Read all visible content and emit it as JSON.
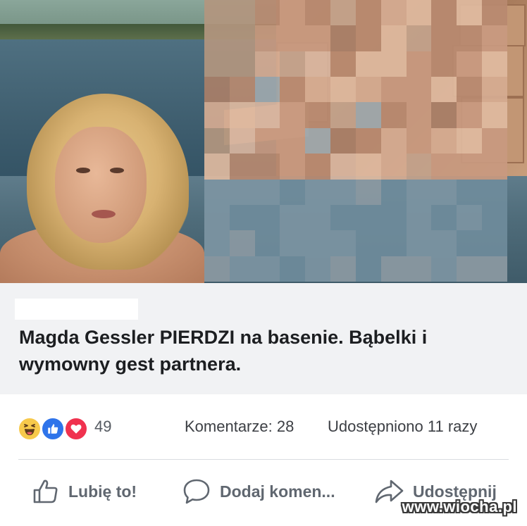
{
  "post": {
    "headline": "Magda Gessler PIERDZI na basenie. Bąbelki i wymowny gest partnera."
  },
  "stats": {
    "reactions": [
      "haha",
      "like",
      "love"
    ],
    "reaction_count": "49",
    "comments": "Komentarze: 28",
    "shares": "Udostępniono 11 razy"
  },
  "actions": {
    "like": "Lubię to!",
    "comment": "Dodaj komen...",
    "share": "Udostępnij"
  },
  "watermark": "www.wiocha.pl",
  "colors": {
    "link_box_bg": "#f1f2f4",
    "headline": "#1c1e21",
    "action_text": "#606770",
    "like_blue": "#2f74ea",
    "love_red": "#f0324f",
    "haha_yellow": "#f7c94b"
  }
}
